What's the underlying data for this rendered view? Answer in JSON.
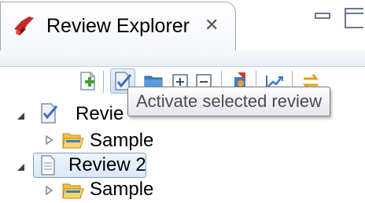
{
  "tab": {
    "title": "Review Explorer",
    "close_glyph": "✕",
    "icon": "review-explorer-icon"
  },
  "window_controls": {
    "minimize_icon": "minimize-icon",
    "maximize_icon": "maximize-icon"
  },
  "toolbar": {
    "buttons": [
      {
        "name": "new-review-button",
        "icon": "new-review-icon"
      },
      {
        "name": "activate-review-button",
        "icon": "activate-review-icon",
        "selected": true
      },
      {
        "name": "open-folder-button",
        "icon": "folder-icon"
      },
      {
        "name": "expand-all-button",
        "icon": "expand-all-icon"
      },
      {
        "name": "collapse-all-button",
        "icon": "collapse-all-icon"
      },
      {
        "name": "import-button",
        "icon": "import-icon"
      },
      {
        "name": "export-chart-button",
        "icon": "chart-icon"
      },
      {
        "name": "sync-button",
        "icon": "sync-icon"
      }
    ]
  },
  "tooltip": {
    "text": "Activate selected review"
  },
  "tree": {
    "nodes": [
      {
        "label": "Review 1",
        "label_visible": "Revie",
        "expanded": true,
        "active": true,
        "children": [
          {
            "label": "Sample",
            "expanded": false
          }
        ]
      },
      {
        "label": "Review 2",
        "expanded": true,
        "selected": true,
        "children": [
          {
            "label": "Sample",
            "expanded": false
          }
        ]
      }
    ]
  },
  "colors": {
    "accent": "#7da2ce",
    "folder_yellow": "#f5c342",
    "folder_blue": "#3f7dc4",
    "tab_border": "#9aa8b8"
  }
}
